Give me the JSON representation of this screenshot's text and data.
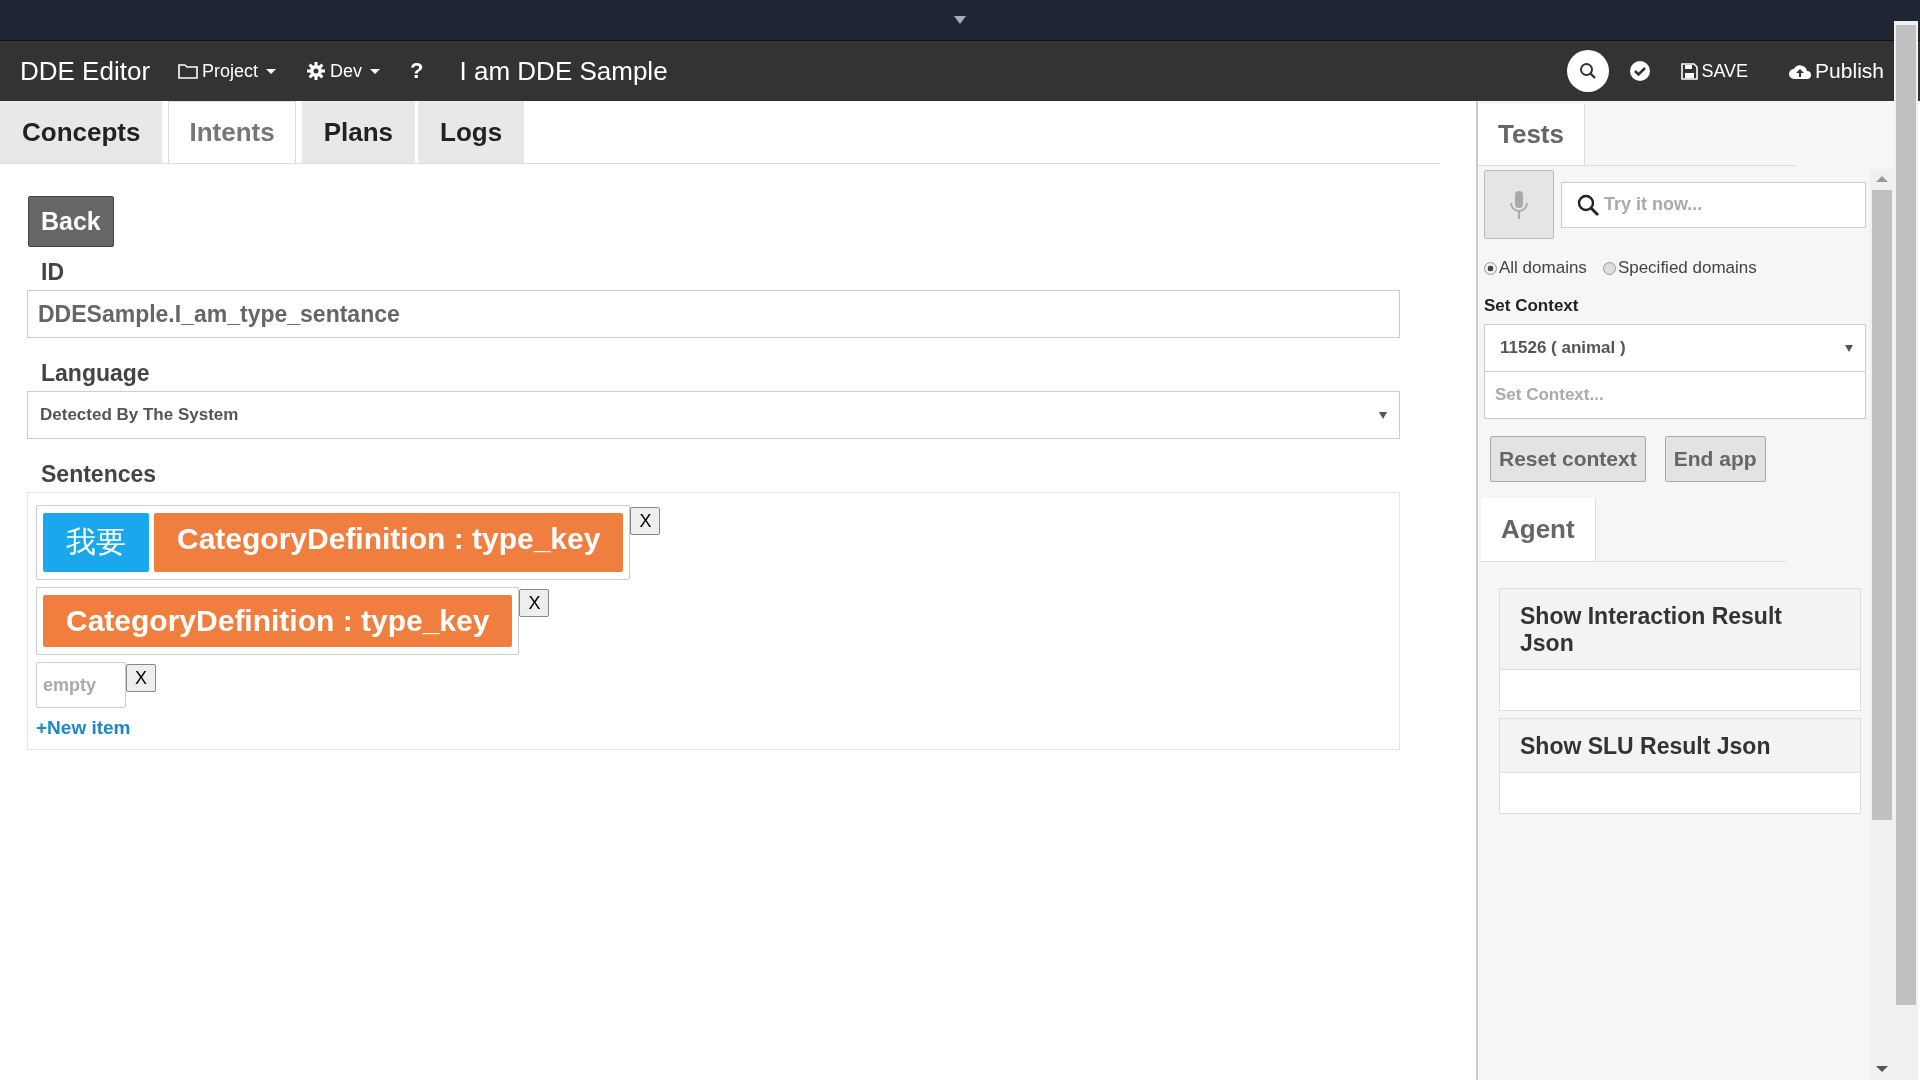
{
  "navbar": {
    "brand": "DDE Editor",
    "menus": [
      {
        "label": "Project"
      },
      {
        "label": "Dev"
      }
    ],
    "help": "?",
    "title": "I am DDE Sample",
    "save": "SAVE",
    "publish": "Publish"
  },
  "tabs": [
    {
      "label": "Concepts",
      "selected": false
    },
    {
      "label": "Intents",
      "selected": true
    },
    {
      "label": "Plans",
      "selected": false
    },
    {
      "label": "Logs",
      "selected": false
    }
  ],
  "back_button": "Back",
  "id_field": {
    "label": "ID",
    "value": "DDESample.I_am_type_sentance"
  },
  "language": {
    "label": "Language",
    "value": "Detected By The System"
  },
  "sentences": {
    "label": "Sentences",
    "items": [
      {
        "tokens": [
          {
            "kind": "text",
            "text": "我要"
          },
          {
            "kind": "slot",
            "text": "CategoryDefinition : type_key"
          }
        ],
        "remove": "X"
      },
      {
        "tokens": [
          {
            "kind": "slot",
            "text": "CategoryDefinition : type_key"
          }
        ],
        "remove": "X"
      },
      {
        "placeholder": "empty",
        "remove": "X"
      }
    ],
    "new_item": "+New item"
  },
  "tests": {
    "tab": "Tests",
    "search_placeholder": "Try it now...",
    "domains": [
      {
        "label": "All domains",
        "selected": true
      },
      {
        "label": "Specified domains",
        "selected": false
      }
    ],
    "context_label": "Set Context",
    "context_value": "11526 ( animal )",
    "context_placeholder": "Set Context...",
    "buttons": [
      "Reset context",
      "End app"
    ]
  },
  "agent": {
    "tab": "Agent",
    "panels": [
      "Show Interaction Result Json",
      "Show SLU Result Json"
    ]
  }
}
